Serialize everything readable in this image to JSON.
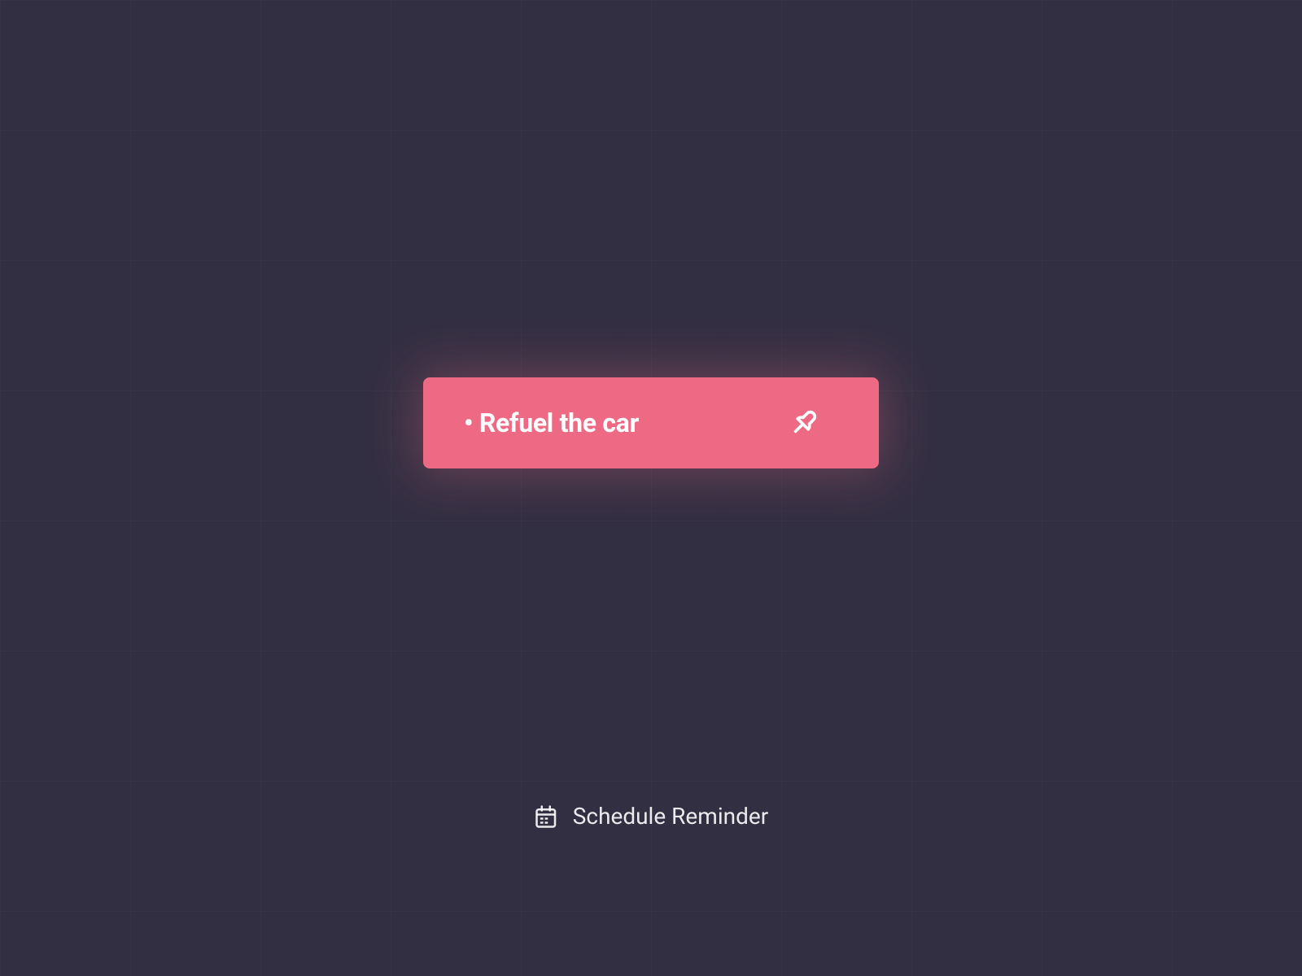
{
  "task": {
    "bullet": "•",
    "title": "Refuel the car"
  },
  "action": {
    "label": "Schedule Reminder"
  },
  "colors": {
    "background": "#332f42",
    "accent": "#ee6a84"
  }
}
